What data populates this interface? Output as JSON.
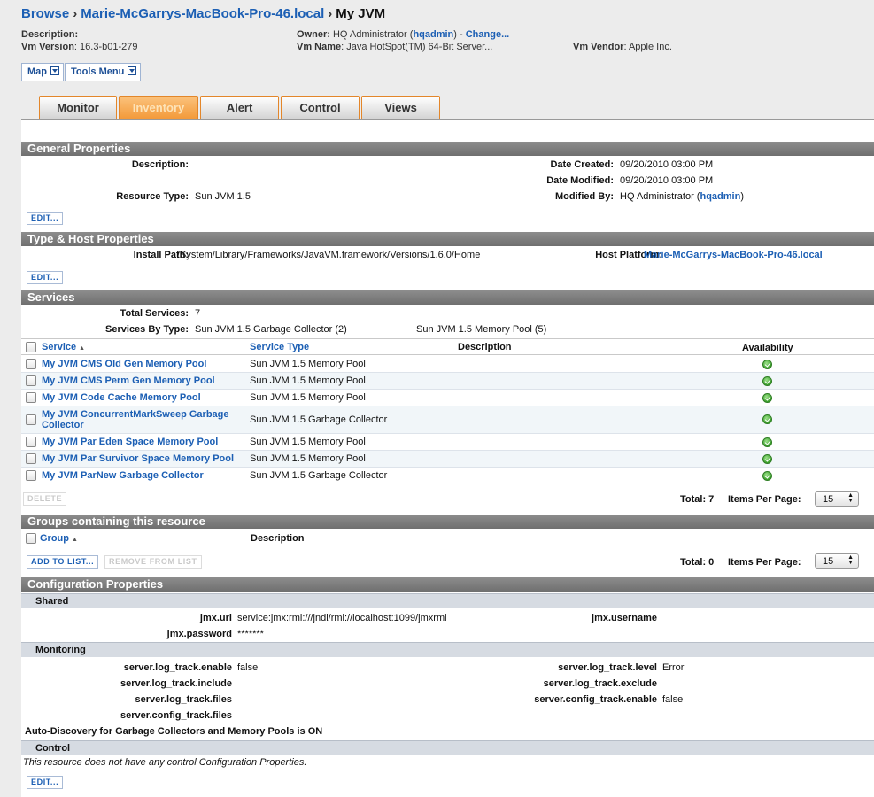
{
  "breadcrumb": {
    "root": "Browse",
    "host": "Marie-McGarrys-MacBook-Pro-46.local",
    "current": "My JVM"
  },
  "header": {
    "description_label": "Description:",
    "description_value": "",
    "owner_label": "Owner:",
    "owner_value": "HQ Administrator (",
    "owner_link": "hqadmin",
    "owner_after": ") - ",
    "change_link": "Change...",
    "vm_version_label": "Vm Version",
    "vm_version_value": ": 16.3-b01-279",
    "vm_name_label": "Vm Name",
    "vm_name_value": ": Java HotSpot(TM) 64-Bit Server...",
    "vm_vendor_label": "Vm Vendor",
    "vm_vendor_value": ": Apple Inc."
  },
  "menus": {
    "map": "Map",
    "tools": "Tools Menu"
  },
  "tabs": [
    "Monitor",
    "Inventory",
    "Alert",
    "Control",
    "Views"
  ],
  "active_tab": "Inventory",
  "general": {
    "title": "General Properties",
    "description_label": "Description:",
    "description_value": "",
    "resource_type_label": "Resource Type:",
    "resource_type_value": "Sun JVM 1.5",
    "date_created_label": "Date Created:",
    "date_created_value": "09/20/2010 03:00 PM",
    "date_modified_label": "Date Modified:",
    "date_modified_value": "09/20/2010 03:00 PM",
    "modified_by_label": "Modified By:",
    "modified_by_value": "HQ Administrator (",
    "modified_by_link": "hqadmin",
    "modified_by_after": ")",
    "edit": "EDIT..."
  },
  "typehost": {
    "title": "Type & Host Properties",
    "install_path_label": "Install Path:",
    "install_path_value": "/System/Library/Frameworks/JavaVM.framework/Versions/1.6.0/Home",
    "host_platform_label": "Host Platform:",
    "host_platform_value": "Marie-McGarrys-MacBook-Pro-46.local",
    "edit": "EDIT..."
  },
  "services": {
    "title": "Services",
    "total_label": "Total Services:",
    "total_value": "7",
    "by_type_label": "Services By Type:",
    "by_type_1": "Sun JVM 1.5 Garbage Collector (2)",
    "by_type_2": "Sun JVM 1.5 Memory Pool (5)",
    "columns": {
      "service": "Service",
      "type": "Service Type",
      "description": "Description",
      "availability": "Availability"
    },
    "rows": [
      {
        "name": "My JVM CMS Old Gen Memory Pool",
        "type": "Sun JVM 1.5 Memory Pool",
        "description": "",
        "availability": "up"
      },
      {
        "name": "My JVM CMS Perm Gen Memory Pool",
        "type": "Sun JVM 1.5 Memory Pool",
        "description": "",
        "availability": "up"
      },
      {
        "name": "My JVM Code Cache Memory Pool",
        "type": "Sun JVM 1.5 Memory Pool",
        "description": "",
        "availability": "up"
      },
      {
        "name": "My JVM ConcurrentMarkSweep Garbage Collector",
        "type": "Sun JVM 1.5 Garbage Collector",
        "description": "",
        "availability": "up"
      },
      {
        "name": "My JVM Par Eden Space Memory Pool",
        "type": "Sun JVM 1.5 Memory Pool",
        "description": "",
        "availability": "up"
      },
      {
        "name": "My JVM Par Survivor Space Memory Pool",
        "type": "Sun JVM 1.5 Memory Pool",
        "description": "",
        "availability": "up"
      },
      {
        "name": "My JVM ParNew Garbage Collector",
        "type": "Sun JVM 1.5 Garbage Collector",
        "description": "",
        "availability": "up"
      }
    ],
    "delete": "DELETE",
    "total_text": "Total: 7",
    "items_per_page_label": "Items Per Page:",
    "items_per_page": "15"
  },
  "groups": {
    "title": "Groups containing this resource",
    "columns": {
      "group": "Group",
      "description": "Description"
    },
    "add": "ADD TO LIST...",
    "remove": "REMOVE FROM LIST",
    "total_text": "Total: 0",
    "items_per_page_label": "Items Per Page:",
    "items_per_page": "15"
  },
  "config": {
    "title": "Configuration Properties",
    "shared_title": "Shared",
    "jmx_url_label": "jmx.url",
    "jmx_url_value": "service:jmx:rmi:///jndi/rmi://localhost:1099/jmxrmi",
    "jmx_username_label": "jmx.username",
    "jmx_username_value": "",
    "jmx_password_label": "jmx.password",
    "jmx_password_value": "*******",
    "monitoring_title": "Monitoring",
    "log_enable_label": "server.log_track.enable",
    "log_enable_value": "false",
    "log_level_label": "server.log_track.level",
    "log_level_value": "Error",
    "log_include_label": "server.log_track.include",
    "log_include_value": "",
    "log_exclude_label": "server.log_track.exclude",
    "log_exclude_value": "",
    "log_files_label": "server.log_track.files",
    "log_files_value": "",
    "config_enable_label": "server.config_track.enable",
    "config_enable_value": "false",
    "config_files_label": "server.config_track.files",
    "config_files_value": "",
    "autodiscovery": "Auto-Discovery for Garbage Collectors and Memory Pools is ON",
    "control_title": "Control",
    "control_note": "This resource does not have any control Configuration Properties.",
    "edit": "EDIT..."
  }
}
